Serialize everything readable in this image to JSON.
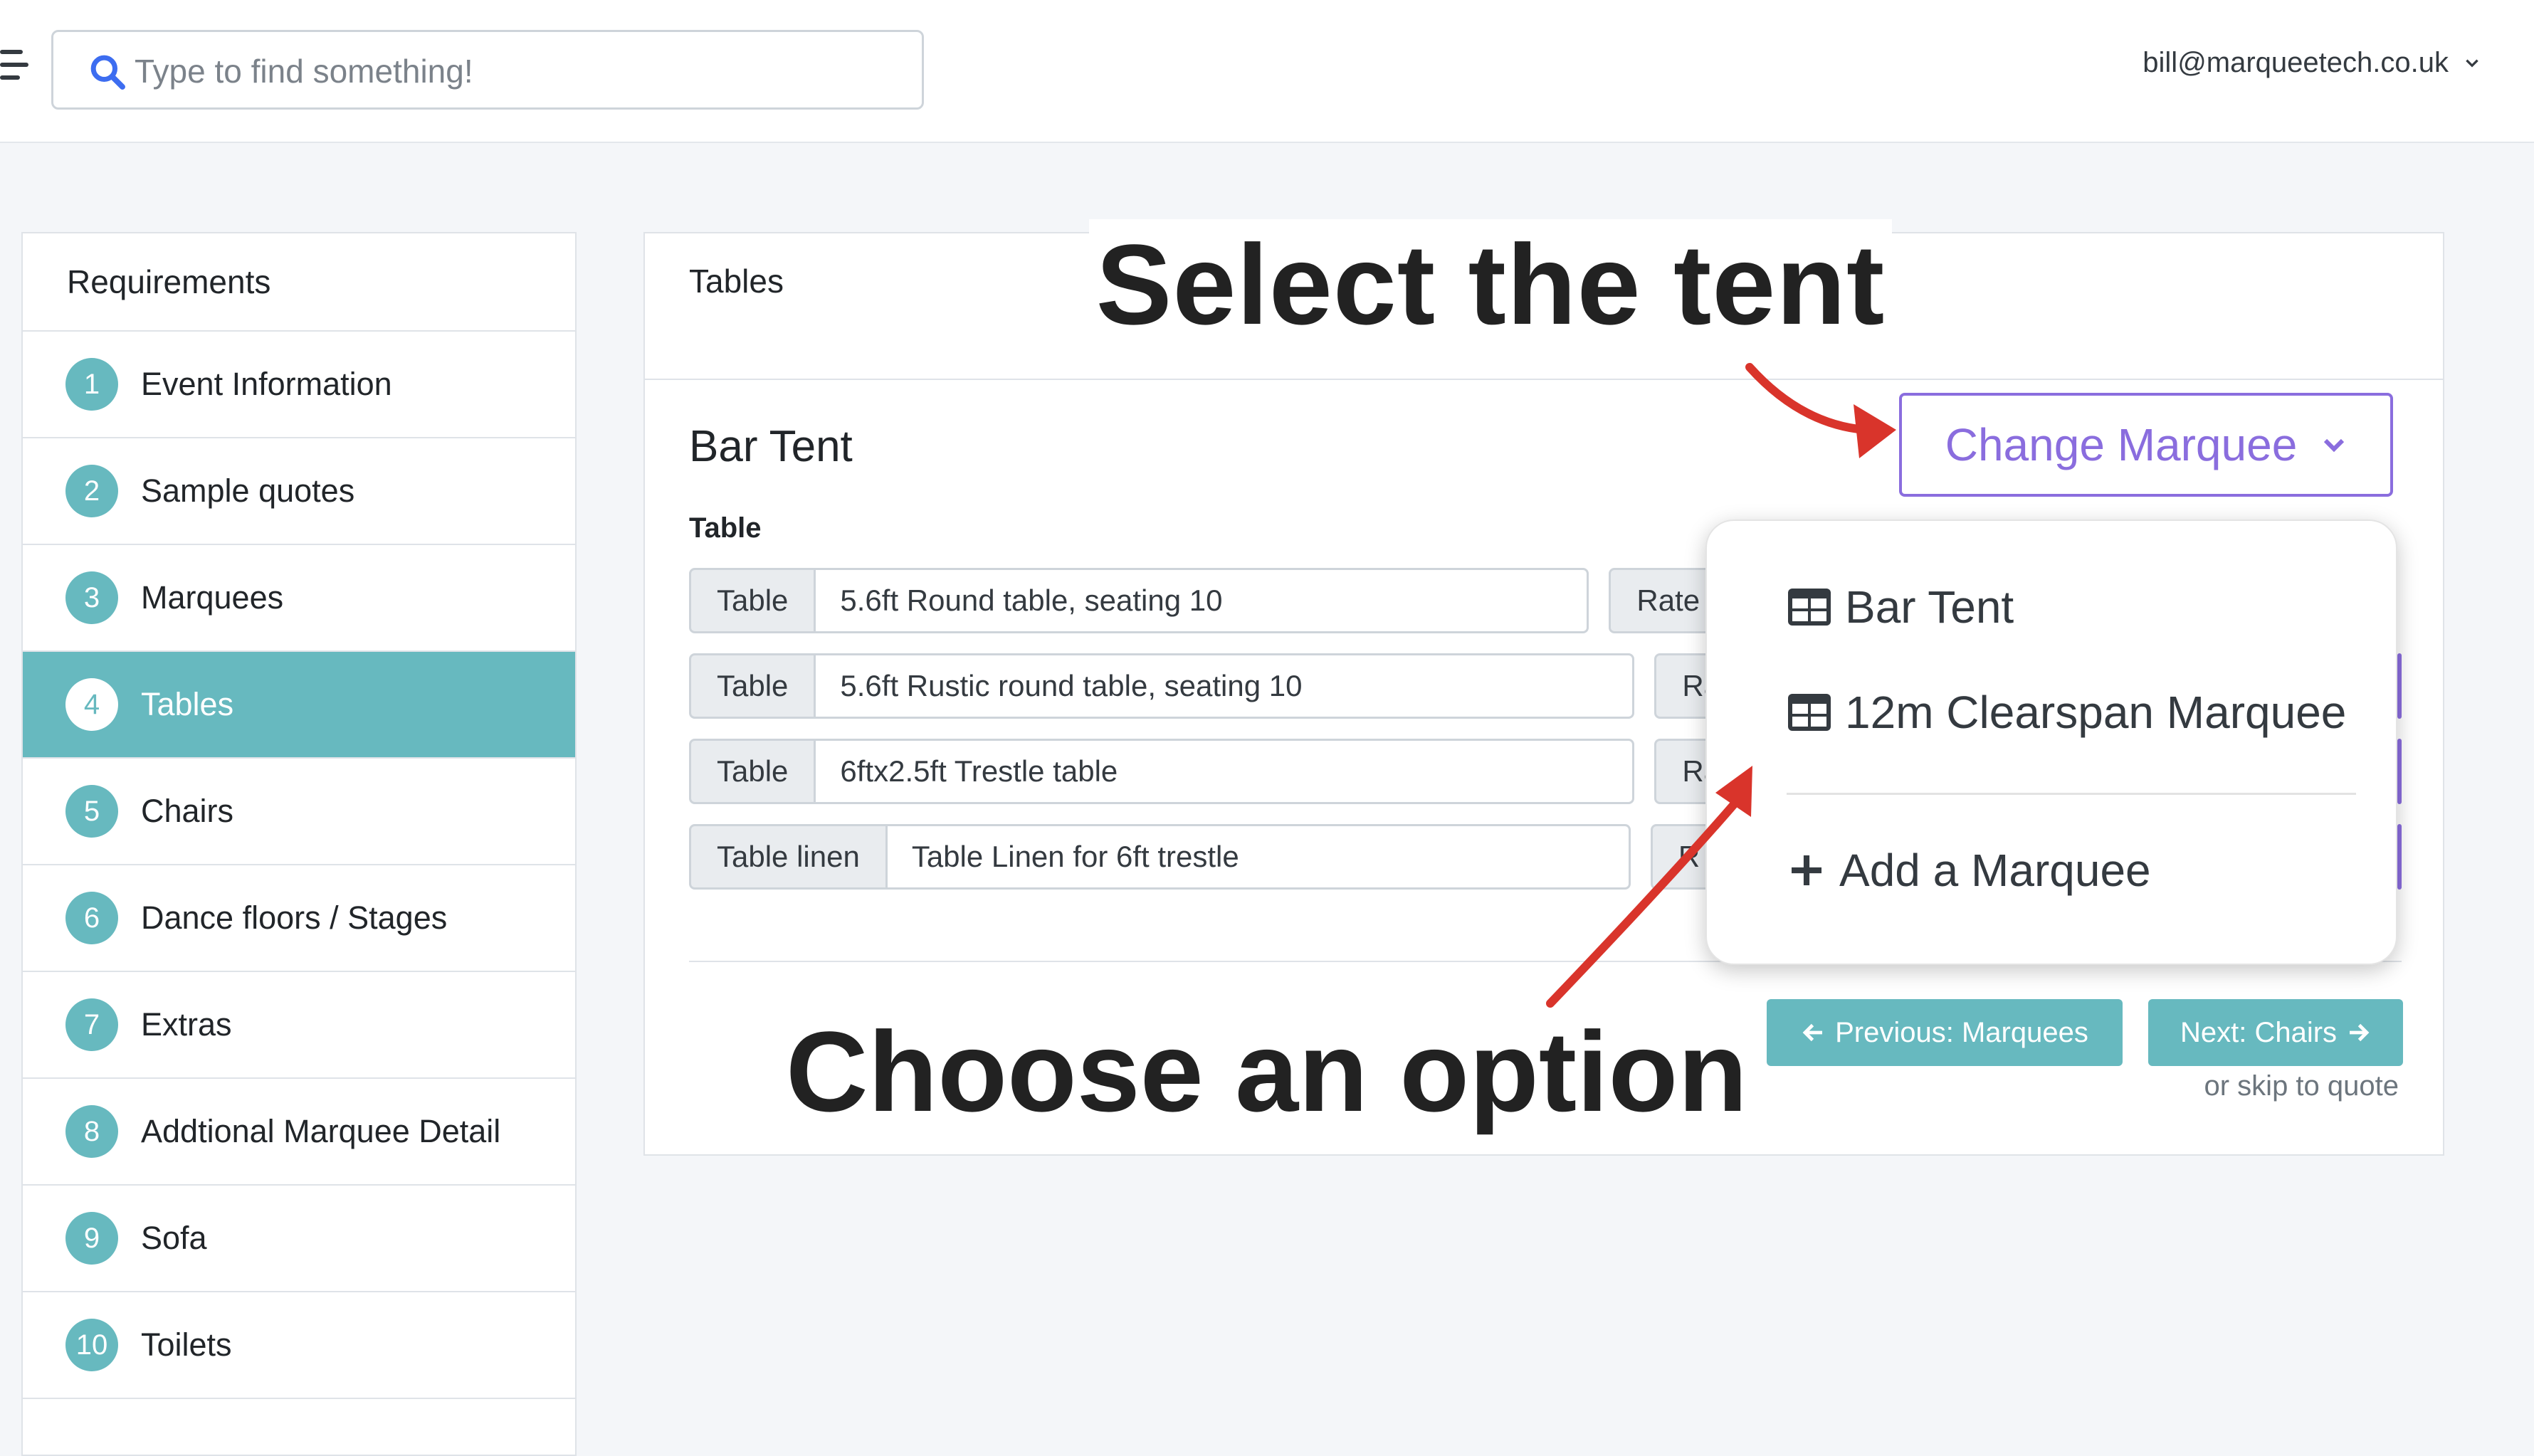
{
  "header": {
    "search_placeholder": "Type to find something!",
    "user_email": "bill@marqueetech.co.uk"
  },
  "sidebar": {
    "title": "Requirements",
    "items": [
      {
        "num": "1",
        "label": "Event Information"
      },
      {
        "num": "2",
        "label": "Sample quotes"
      },
      {
        "num": "3",
        "label": "Marquees"
      },
      {
        "num": "4",
        "label": "Tables"
      },
      {
        "num": "5",
        "label": "Chairs"
      },
      {
        "num": "6",
        "label": "Dance floors / Stages"
      },
      {
        "num": "7",
        "label": "Extras"
      },
      {
        "num": "8",
        "label": "Addtional Marquee Detail"
      },
      {
        "num": "9",
        "label": "Sofa"
      },
      {
        "num": "10",
        "label": "Toilets"
      }
    ],
    "active_index": 3
  },
  "main": {
    "card_title": "Tables",
    "section_title": "Bar Tent",
    "field_label": "Table",
    "rows": [
      {
        "addon": "Table",
        "value": "5.6ft Round table, seating 10",
        "rate": "Rate"
      },
      {
        "addon": "Table",
        "value": "5.6ft Rustic round table, seating 10",
        "rate": "Ra"
      },
      {
        "addon": "Table",
        "value": "6ftx2.5ft Trestle table",
        "rate": "Ra"
      },
      {
        "addon": "Table linen",
        "value": "Table Linen for 6ft trestle",
        "rate": "R"
      }
    ],
    "change_button": "Change Marquee",
    "dropdown": {
      "items": [
        "Bar Tent",
        "12m Clearspan Marquee"
      ],
      "add_label": "Add a Marquee"
    },
    "prev_button": "Previous: Marquees",
    "next_button": "Next: Chairs",
    "skip_text": "or skip to quote"
  },
  "annotations": {
    "top": "Select the tent",
    "bottom": "Choose an option"
  },
  "colors": {
    "teal": "#67b9bf",
    "purple": "#8a6dde",
    "arrow_red": "#d9342b"
  }
}
